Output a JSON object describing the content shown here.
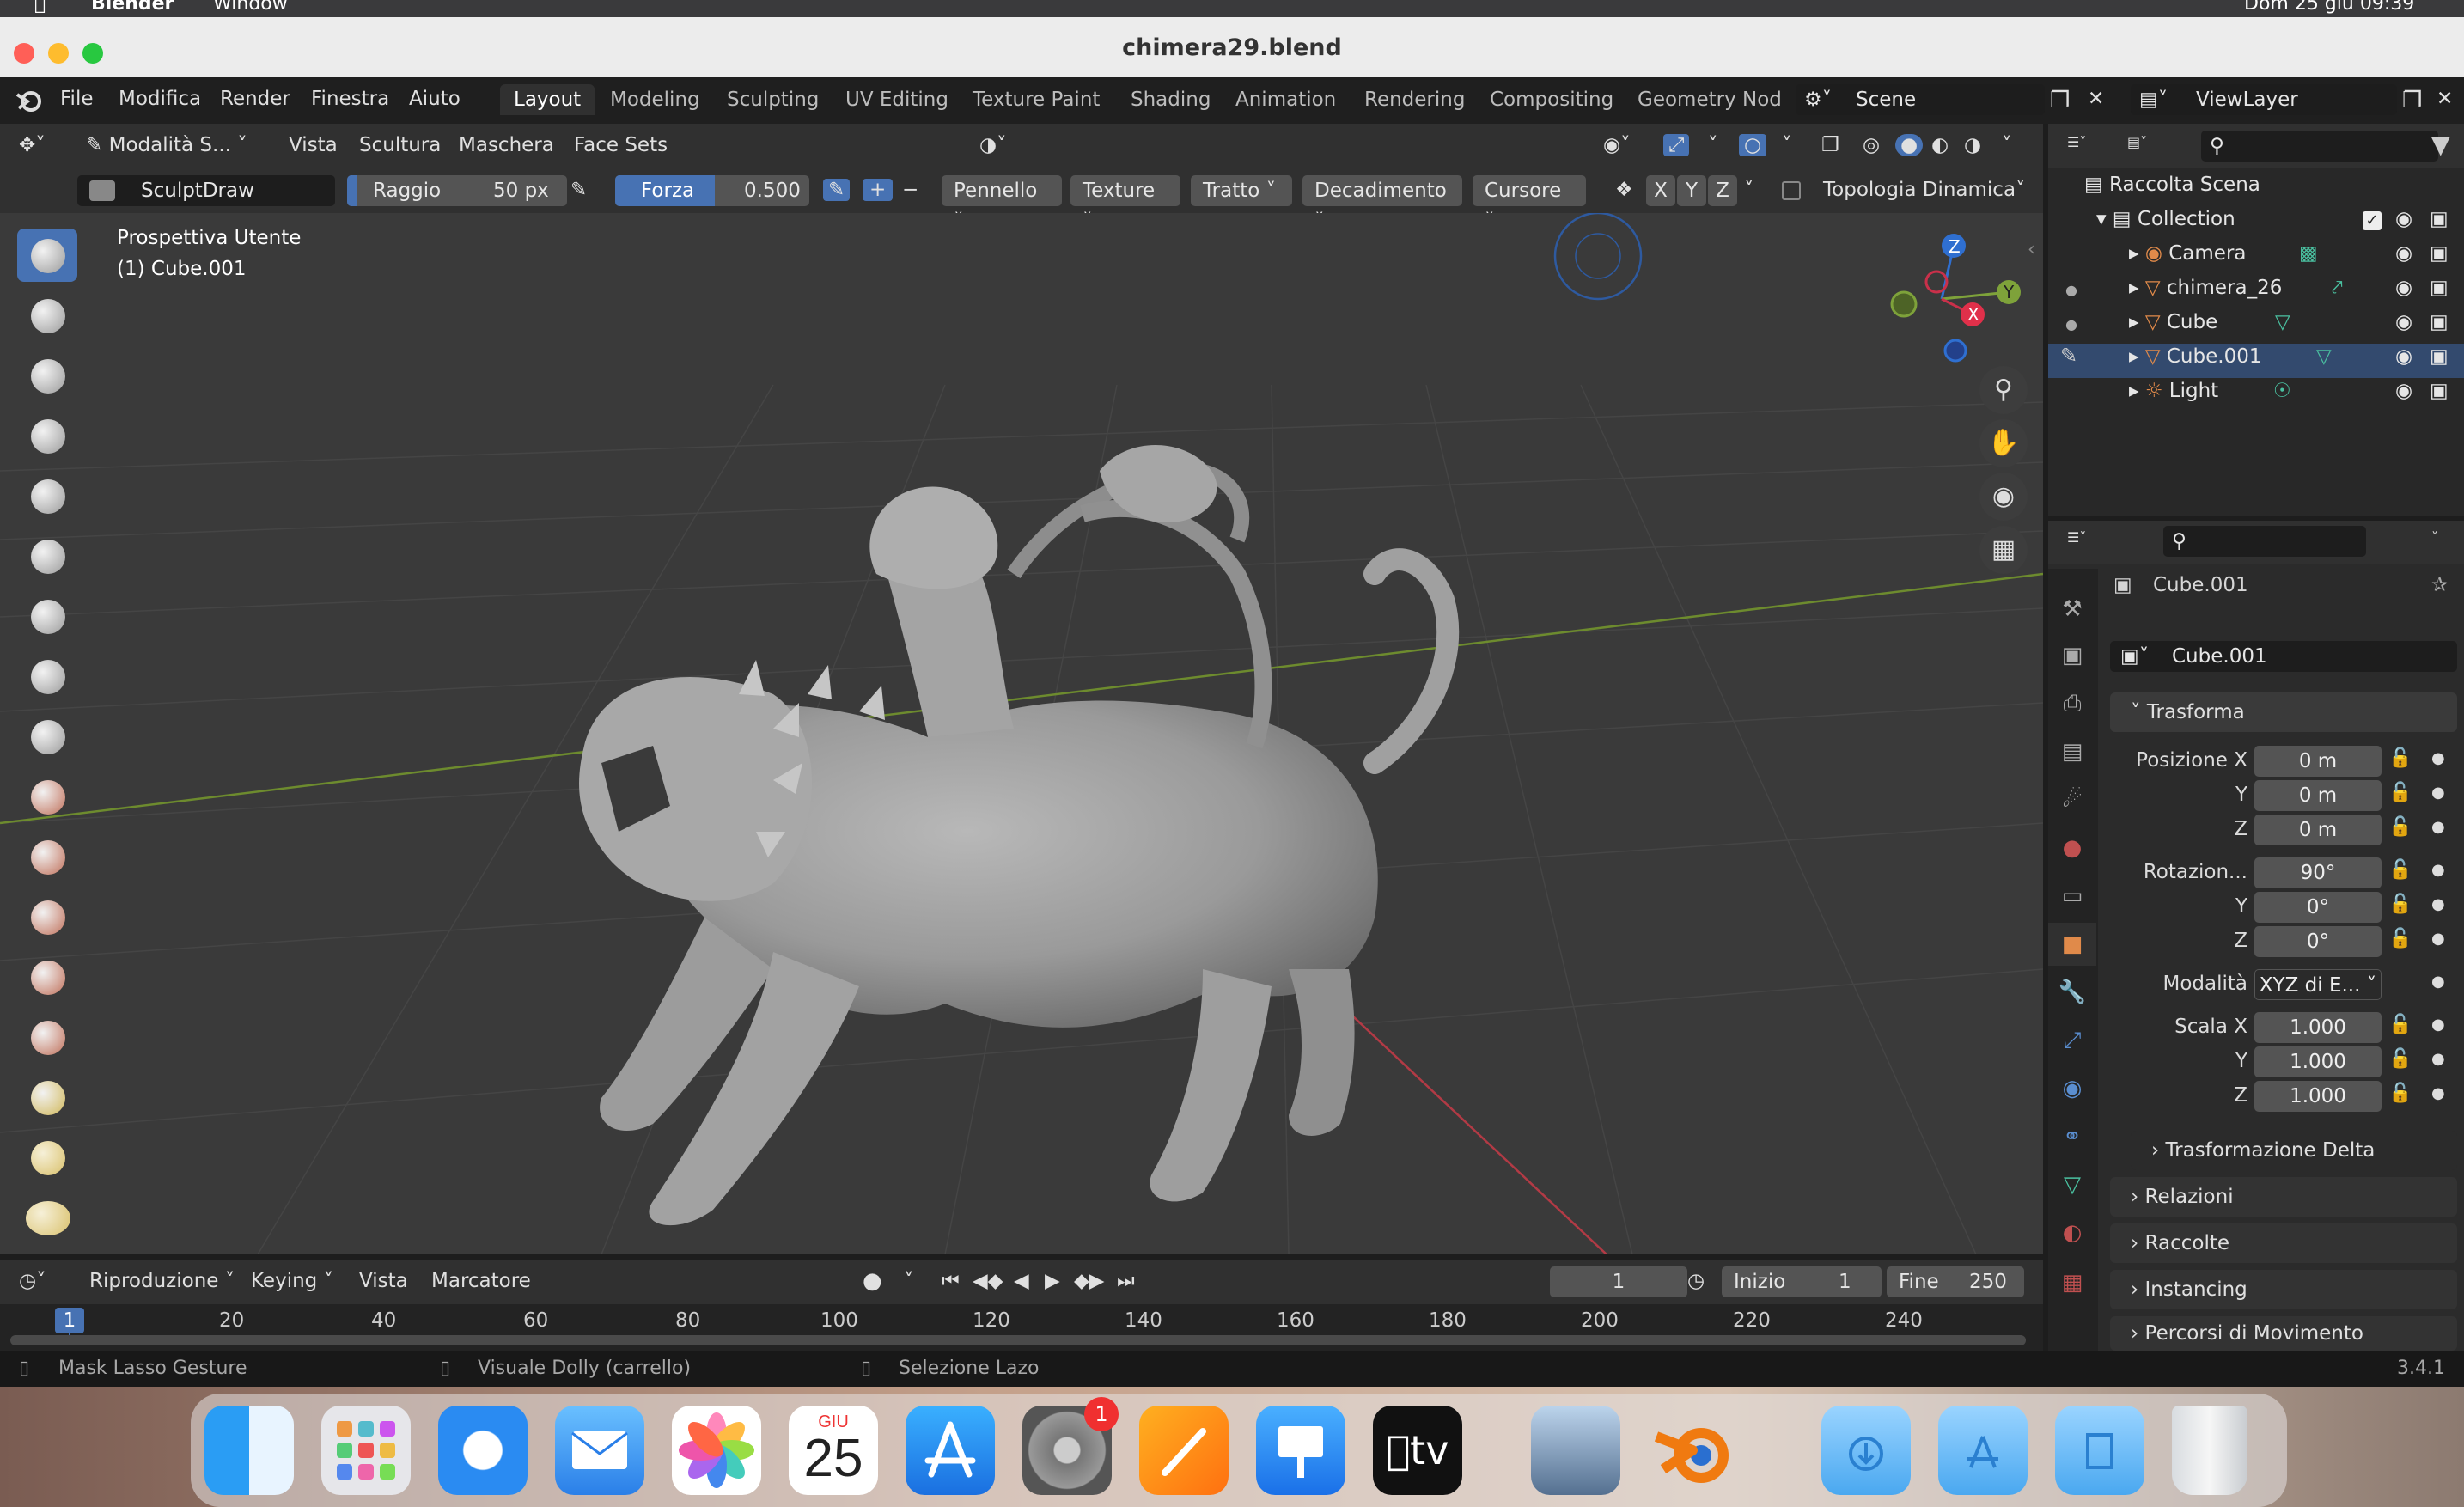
{
  "mac_menu": {
    "app": "Blender",
    "window": "Window",
    "datetime": "Dom 25 giu 09:39"
  },
  "window_title": "chimera29.blend",
  "top_menu": [
    "File",
    "Modifica",
    "Render",
    "Finestra",
    "Aiuto"
  ],
  "workspaces": [
    "Layout",
    "Modeling",
    "Sculpting",
    "UV Editing",
    "Texture Paint",
    "Shading",
    "Animation",
    "Rendering",
    "Compositing",
    "Geometry Nodes"
  ],
  "scene": "Scene",
  "view_layer": "ViewLayer",
  "viewport_header": {
    "mode": "Modalità S...",
    "menus": [
      "Vista",
      "Scultura",
      "Maschera",
      "Face Sets"
    ]
  },
  "tool_header": {
    "brush": "SculptDraw",
    "radius_label": "Raggio",
    "radius_value": "50 px",
    "strength_label": "Forza",
    "strength_value": "0.500",
    "menus": [
      "Pennello",
      "Texture",
      "Tratto",
      "Decadimento",
      "Cursore"
    ],
    "axes": [
      "X",
      "Y",
      "Z"
    ],
    "dyntopo": "Topologia Dinamica"
  },
  "viewport": {
    "view_name": "Prospettiva Utente",
    "object": "(1) Cube.001"
  },
  "timeline": {
    "menus": [
      "Riproduzione",
      "Keying",
      "Vista",
      "Marcatore"
    ],
    "current_frame": "1",
    "start_label": "Inizio",
    "start": "1",
    "end_label": "Fine",
    "end": "250",
    "marker_current": "1",
    "ticks": [
      "20",
      "40",
      "60",
      "80",
      "100",
      "120",
      "140",
      "160",
      "180",
      "200",
      "220",
      "240"
    ]
  },
  "status": {
    "left": "Mask Lasso Gesture",
    "mid": "Visuale Dolly (carrello)",
    "right": "Selezione Lazo",
    "version": "3.4.1"
  },
  "outliner": {
    "root": "Raccolta Scena",
    "collection": "Collection",
    "items": [
      "Camera",
      "chimera_26",
      "Cube",
      "Cube.001",
      "Light"
    ]
  },
  "properties": {
    "object_name": "Cube.001",
    "data_name": "Cube.001",
    "transform": "Trasforma",
    "pos_label": "Posizione X",
    "rot_label": "Rotazion...",
    "mode_label": "Modalità",
    "mode_value": "XYZ di E...",
    "scale_label": "Scala X",
    "y": "Y",
    "z": "Z",
    "pos": [
      "0 m",
      "0 m",
      "0 m"
    ],
    "rot": [
      "90°",
      "0°",
      "0°"
    ],
    "scale": [
      "1.000",
      "1.000",
      "1.000"
    ],
    "panels": [
      "Trasformazione Delta",
      "Relazioni",
      "Raccolte",
      "Instancing",
      "Percorsi di Movimento"
    ]
  },
  "dock": {
    "calendar_month": "GIU",
    "calendar_day": "25",
    "settings_badge": "1",
    "tv_label": "tv"
  },
  "colors": {
    "accent": "#4772b3",
    "x_axis": "#c9304a",
    "y_axis": "#7ea23a",
    "z_axis": "#2f6fd0"
  }
}
